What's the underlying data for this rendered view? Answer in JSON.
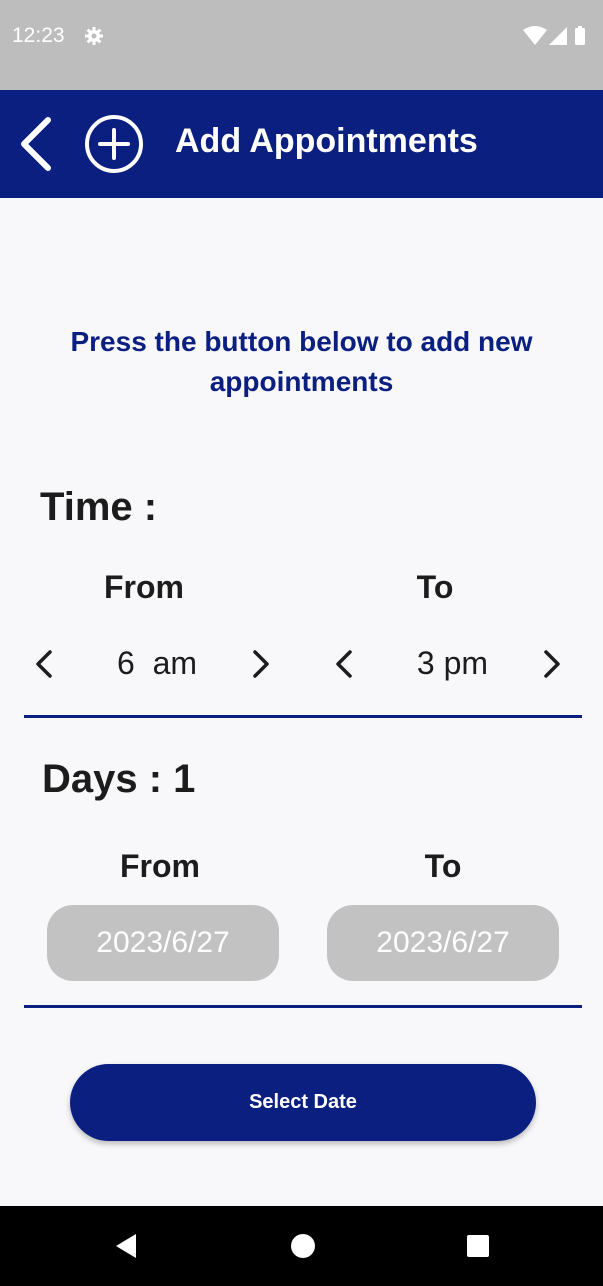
{
  "status_bar": {
    "time": "12:23",
    "icons": [
      "settings-icon",
      "wifi-icon",
      "signal-icon",
      "battery-icon"
    ]
  },
  "app_bar": {
    "title": "Add Appointments",
    "color": "#0a1f80"
  },
  "instructions": "Press the button below to add new appointments",
  "time_section": {
    "title": "Time :",
    "from_label": "From",
    "to_label": "To",
    "from_value": "6  am",
    "to_value": "3 pm"
  },
  "days_section": {
    "title": "Days : 1",
    "from_label": "From",
    "to_label": "To",
    "from_date": "2023/6/27",
    "to_date": "2023/6/27"
  },
  "select_date_button": "Select Date",
  "nav_bar": {
    "icons": [
      "back-triangle-icon",
      "home-circle-icon",
      "recents-square-icon"
    ]
  },
  "colors": {
    "primary": "#0a1f80",
    "status_bar": "#bdbdbd",
    "date_field": "#c2c2c2",
    "background": "#f8f8fa"
  }
}
